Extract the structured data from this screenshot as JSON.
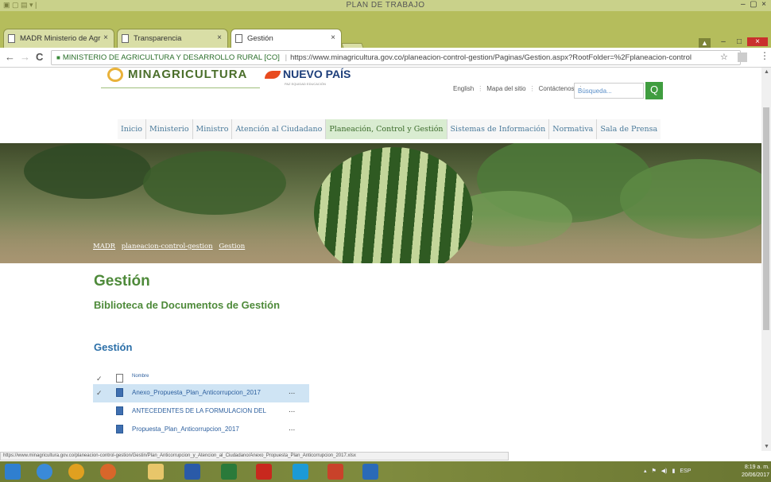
{
  "window": {
    "title": "PLAN DE TRABAJO",
    "controls": [
      "–",
      "□",
      "×"
    ]
  },
  "tabs": [
    {
      "label": "MADR Ministerio de Agr",
      "close": "×"
    },
    {
      "label": "Transparencia",
      "close": "×"
    },
    {
      "label": "Gestión",
      "close": "×"
    }
  ],
  "browser": {
    "back_icon": "←",
    "forward_icon": "→",
    "reload_icon": "C",
    "site_name": "MINISTERIO DE AGRICULTURA Y DESARROLLO RURAL [CO]",
    "url": "https://www.minagricultura.gov.co/planeacion-control-gestion/Paginas/Gestion.aspx?RootFolder=%2Fplaneacion-control",
    "star_icon": "☆",
    "menu_icon": "⋮"
  },
  "header": {
    "logo_text": "MINAGRICULTURA",
    "brand2": "NUEVO PAÍS",
    "brand2_tag": "PAZ EQUIDAD EDUCACIÓN",
    "links": [
      "English",
      "Mapa del sitio",
      "Contáctenos"
    ],
    "search_placeholder": "Búsqueda...",
    "search_icon": "Q"
  },
  "main_nav": [
    "Inicio",
    "Ministerio",
    "Ministro",
    "Atención al Ciudadano",
    "Planeación, Control y Gestión",
    "Sistemas de Información",
    "Normativa",
    "Sala de Prensa"
  ],
  "breadcrumb": [
    "MADR",
    "planeacion-control-gestion",
    "Gestion"
  ],
  "content": {
    "title": "Gestión",
    "subtitle": "Biblioteca de Documentos de Gestión",
    "section": "Gestión"
  },
  "documents": {
    "header": "Nombre",
    "rows": [
      {
        "name": "Anexo_Propuesta_Plan_Anticorrupcion_2017",
        "checked": "✓",
        "menu": "..."
      },
      {
        "name": "ANTECEDENTES DE LA FORMULACION DEL",
        "checked": "",
        "menu": "..."
      },
      {
        "name": "Propuesta_Plan_Anticorrupcion_2017",
        "checked": "",
        "menu": "..."
      }
    ]
  },
  "status_url": "https://www.minagricultura.gov.co/planeacion-control-gestion/Gestin/Plan_Anticorrupcion_y_Atencion_al_Ciudadano/Anexo_Propuesta_Plan_Anticorrupcion_2017.xlsx",
  "taskbar": {
    "tray_lang": "ESP",
    "time": "8:19 a. m.",
    "date": "20/06/2017"
  }
}
